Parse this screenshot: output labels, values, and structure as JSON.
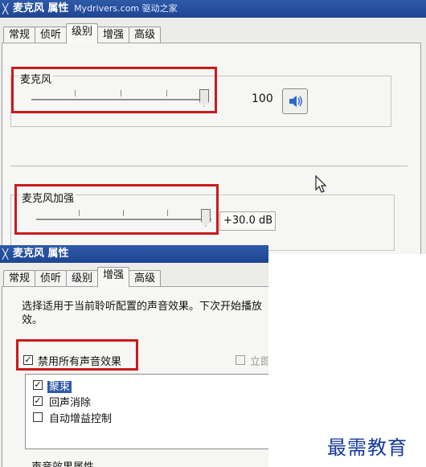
{
  "top_window": {
    "title": "麦克风 属性",
    "watermark_text": "Mydrivers.com 驱动之家",
    "tabs": [
      "常规",
      "侦听",
      "级别",
      "增强",
      "高级"
    ],
    "active_tab": "级别",
    "mic_group": {
      "label": "麦克风",
      "value": "100",
      "level_fraction": 1.0
    },
    "boost_group": {
      "label": "麦克风加强",
      "value": "+30.0 dB",
      "level_fraction": 1.0
    }
  },
  "bottom_window": {
    "title": "麦克风 属性",
    "tabs": [
      "常规",
      "侦听",
      "级别",
      "增强",
      "高级"
    ],
    "active_tab": "增强",
    "description": "选择适用于当前聆听配置的声音效果。下次开始播放效。",
    "disable_all": {
      "label": "禁用所有声音效果",
      "checked": true
    },
    "immediate": {
      "label": "立即",
      "checked": false
    },
    "effects": [
      {
        "label": "聚束",
        "checked": true,
        "selected": true
      },
      {
        "label": "回声消除",
        "checked": true
      },
      {
        "label": "自动增益控制",
        "checked": false
      }
    ],
    "properties_label": "声音效果属性"
  },
  "site_watermark": "最需教育",
  "colors": {
    "title_bar": "#2f5aa8",
    "highlight_border": "#c81b1b",
    "watermark": "#143a9a"
  },
  "icons": {
    "speaker": "speaker-icon",
    "close": "close-icon",
    "cursor": "mouse-pointer-icon"
  }
}
